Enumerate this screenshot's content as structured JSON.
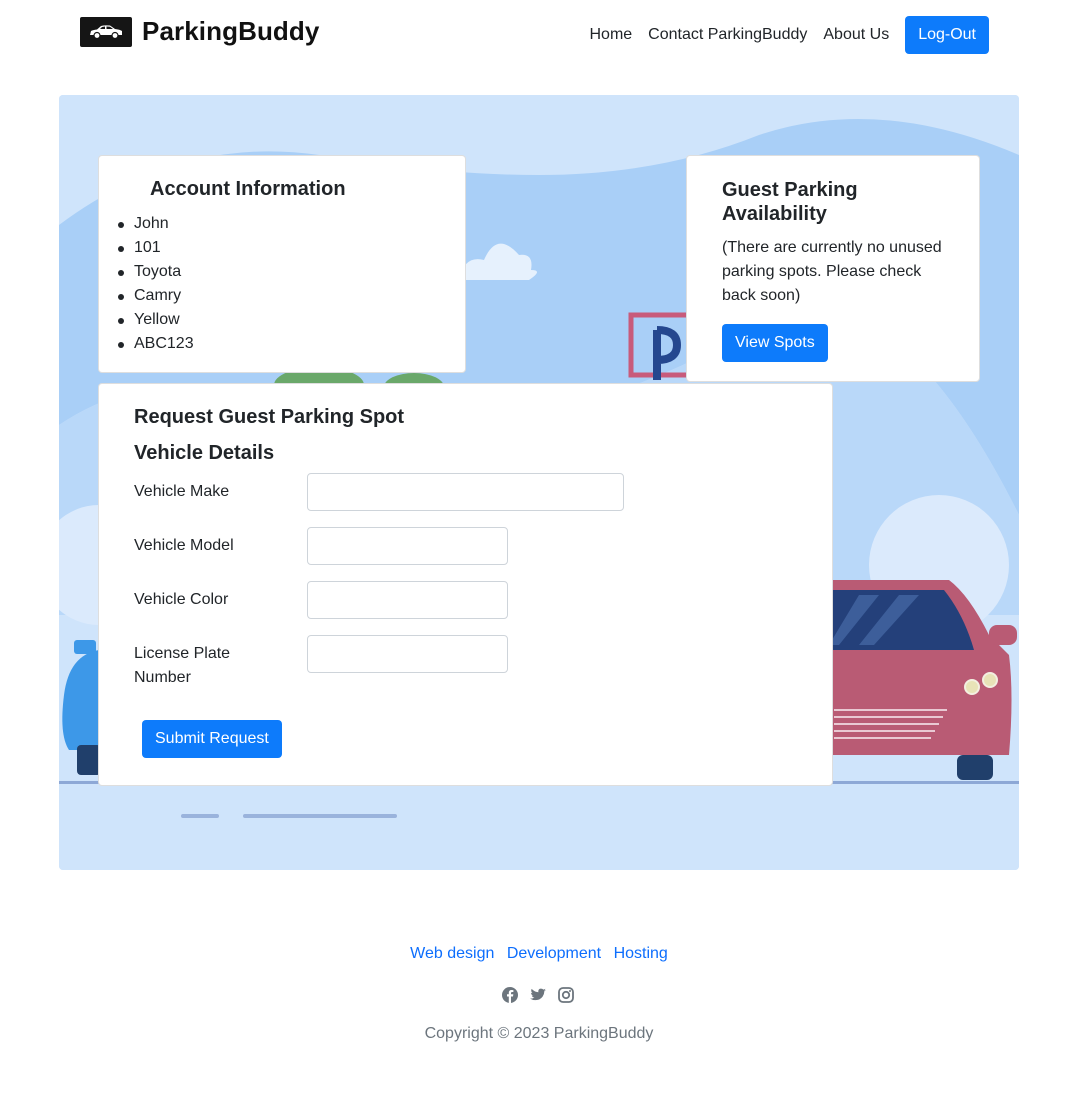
{
  "header": {
    "brand": "ParkingBuddy",
    "nav": [
      "Home",
      "Contact ParkingBuddy",
      "About Us"
    ],
    "logout_label": "Log-Out"
  },
  "account": {
    "title": "Account Information",
    "items": [
      "John",
      "101",
      "Toyota",
      "Camry",
      "Yellow",
      "ABC123"
    ]
  },
  "guest": {
    "title": "Guest Parking Availability",
    "message": "(There are currently no unused parking spots. Please check back soon)",
    "button_label": "View Spots"
  },
  "request": {
    "title": "Request Guest Parking Spot",
    "subtitle": "Vehicle Details",
    "fields": [
      {
        "label": "Vehicle Make",
        "value": ""
      },
      {
        "label": "Vehicle Model",
        "value": ""
      },
      {
        "label": "Vehicle Color",
        "value": ""
      },
      {
        "label": "License Plate Number",
        "value": ""
      }
    ],
    "submit_label": "Submit Request"
  },
  "footer": {
    "links": [
      "Web design",
      "Development",
      "Hosting"
    ],
    "social_icons": [
      "facebook-icon",
      "twitter-icon",
      "instagram-icon"
    ],
    "copyright": "Copyright © 2023 ParkingBuddy"
  },
  "colors": {
    "primary": "#0d7bfb",
    "link": "#0d6efd",
    "hero_bg": "#cfe4fb"
  }
}
